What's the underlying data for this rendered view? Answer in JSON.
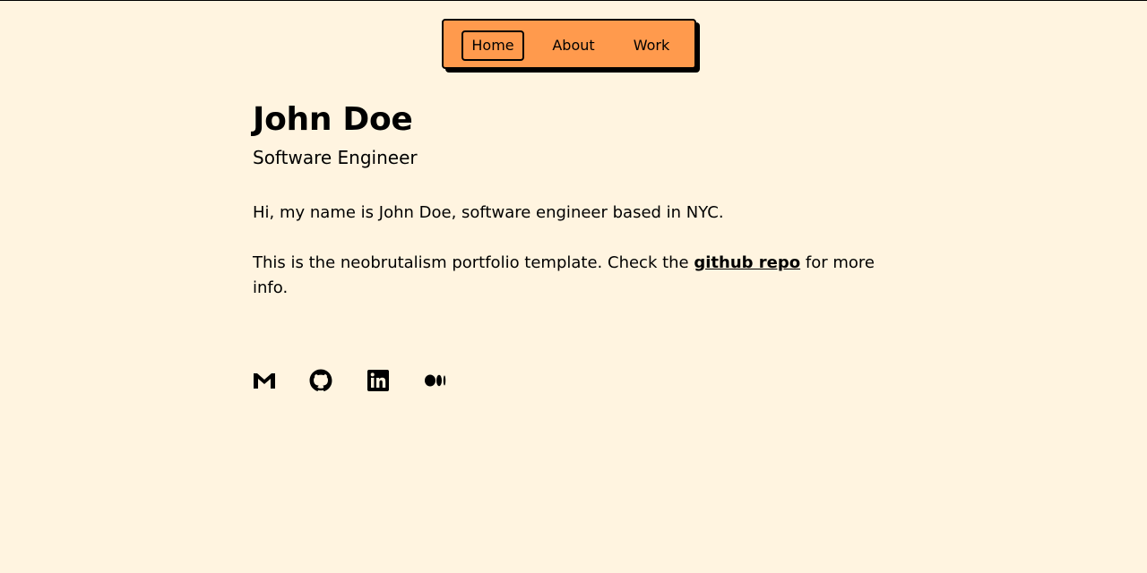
{
  "nav": {
    "items": [
      {
        "label": "Home",
        "active": true
      },
      {
        "label": "About",
        "active": false
      },
      {
        "label": "Work",
        "active": false
      }
    ]
  },
  "profile": {
    "name": "John Doe",
    "title": "Software Engineer"
  },
  "bio": {
    "intro": "Hi, my name is John Doe, software engineer based in NYC.",
    "template_prefix": "This is the neobrutalism portfolio template. Check the ",
    "repo_link": "github repo",
    "template_suffix": " for more info."
  },
  "socials": [
    {
      "icon": "gmail-icon"
    },
    {
      "icon": "github-icon"
    },
    {
      "icon": "linkedin-icon"
    },
    {
      "icon": "medium-icon"
    }
  ],
  "colors": {
    "background": "#fff4e0",
    "nav_background": "#ff9a4d",
    "text": "#000000"
  }
}
